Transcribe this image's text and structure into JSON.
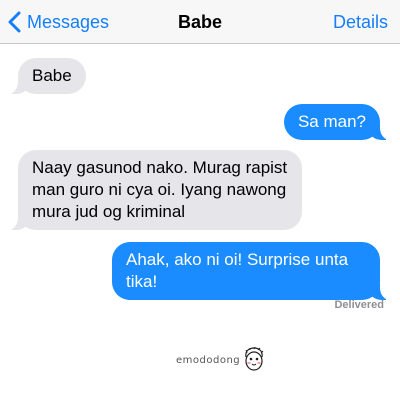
{
  "navbar": {
    "back_label": "Messages",
    "title": "Babe",
    "details_label": "Details",
    "accent_color": "#147efb"
  },
  "messages": [
    {
      "direction": "incoming",
      "text": "Babe"
    },
    {
      "direction": "outgoing",
      "text": "Sa man?"
    },
    {
      "direction": "incoming",
      "text": "Naay gasunod nako. Murag rapist man guro ni cya oi. Iyang nawong mura jud og kriminal"
    },
    {
      "direction": "outgoing",
      "text": "Ahak, ako ni oi! Surprise unta tika!"
    }
  ],
  "status": {
    "delivered": "Delivered"
  },
  "watermark": {
    "text": "emododong"
  },
  "colors": {
    "incoming_bubble": "#e5e5ea",
    "outgoing_bubble": "#1a8cff"
  }
}
